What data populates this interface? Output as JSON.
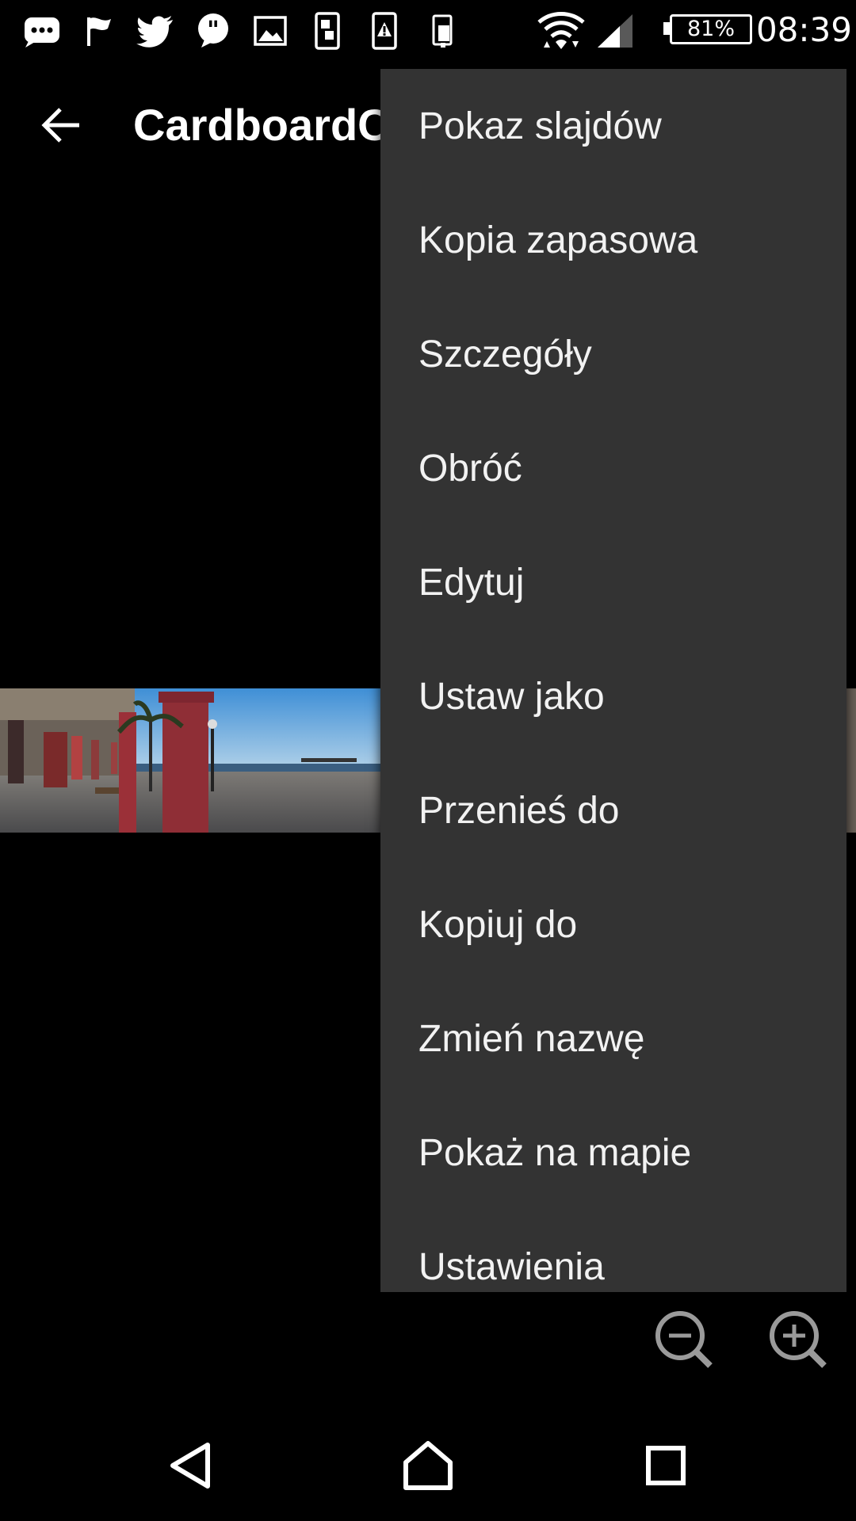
{
  "status_bar": {
    "battery_label": "81%",
    "time": "08:39",
    "left_icons": [
      "messaging-icon",
      "flag-icon",
      "twitter-icon",
      "quote-chat-icon",
      "image-icon",
      "screen-cast-icon",
      "alert-icon",
      "device-icon"
    ],
    "right_icons": [
      "wifi-icon",
      "cell-signal-icon"
    ]
  },
  "toolbar": {
    "title": "CardboardC",
    "back_icon": "arrow-left-icon"
  },
  "menu": {
    "items": [
      {
        "label": "Pokaz slajdów"
      },
      {
        "label": "Kopia zapasowa"
      },
      {
        "label": "Szczegóły"
      },
      {
        "label": "Obróć"
      },
      {
        "label": "Edytuj"
      },
      {
        "label": "Ustaw jako"
      },
      {
        "label": "Przenieś do"
      },
      {
        "label": "Kopiuj do"
      },
      {
        "label": "Zmień nazwę"
      },
      {
        "label": "Pokaż na mapie"
      },
      {
        "label": "Ustawienia"
      }
    ]
  },
  "zoom": {
    "out_icon": "zoom-out-icon",
    "in_icon": "zoom-in-icon"
  },
  "navigation": {
    "back_icon": "nav-back-icon",
    "home_icon": "nav-home-icon",
    "recents_icon": "nav-recents-icon"
  },
  "colors": {
    "background": "#000000",
    "menu_background": "#333333",
    "text": "#ffffff"
  }
}
